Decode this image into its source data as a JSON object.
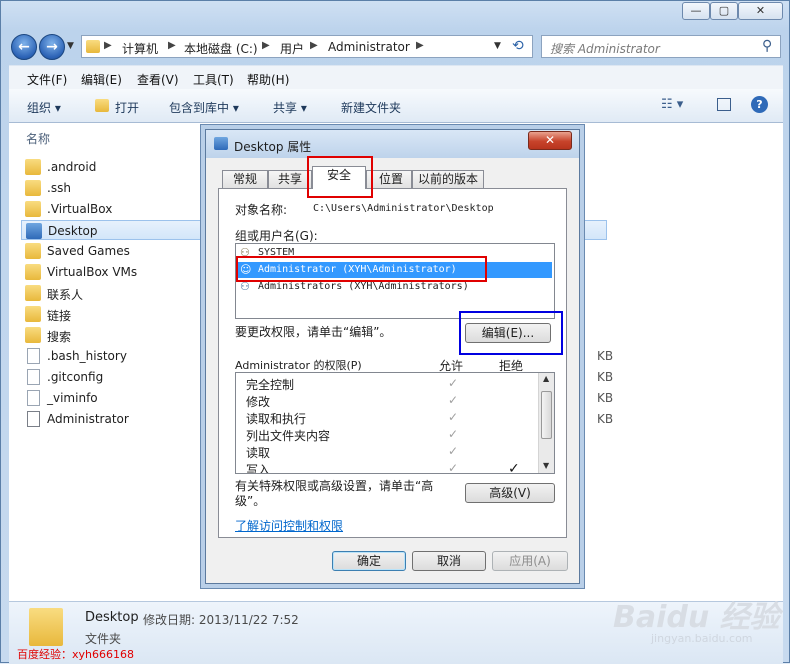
{
  "window": {
    "min_icon": "minimize-icon",
    "max_icon": "maximize-icon",
    "close_icon": "close-icon"
  },
  "address": {
    "crumbs": [
      "计算机",
      "本地磁盘 (C:)",
      "用户",
      "Administrator"
    ],
    "search_placeholder": "搜索 Administrator"
  },
  "menu": [
    "文件(F)",
    "编辑(E)",
    "查看(V)",
    "工具(T)",
    "帮助(H)"
  ],
  "toolbar": {
    "organize": "组织 ▾",
    "open": "打开",
    "include_in_library": "包含到库中 ▾",
    "share": "共享 ▾",
    "new_folder": "新建文件夹"
  },
  "list": {
    "column_name": "名称",
    "items": [
      {
        "name": ".android",
        "type": "folder"
      },
      {
        "name": ".ssh",
        "type": "folder"
      },
      {
        "name": ".VirtualBox",
        "type": "folder"
      },
      {
        "name": "Desktop",
        "type": "folder-desktop",
        "selected": true
      },
      {
        "name": "Saved Games",
        "type": "folder"
      },
      {
        "name": "VirtualBox VMs",
        "type": "folder"
      },
      {
        "name": "联系人",
        "type": "folder-contacts"
      },
      {
        "name": "链接",
        "type": "folder-links"
      },
      {
        "name": "搜索",
        "type": "folder-search"
      },
      {
        "name": ".bash_history",
        "type": "file",
        "size": "KB"
      },
      {
        "name": ".gitconfig",
        "type": "file",
        "size": "KB"
      },
      {
        "name": "_viminfo",
        "type": "file",
        "size": "KB"
      },
      {
        "name": "Administrator",
        "type": "file-special",
        "size": "KB"
      }
    ]
  },
  "details": {
    "name": "Desktop",
    "modified_label": "修改日期: 2013/11/22 7:52",
    "type": "文件夹"
  },
  "watermark": {
    "baidu": "Baidu 经验",
    "site": "jingyan.baidu.com",
    "author": "百度经验：xyh666168"
  },
  "dialog": {
    "title": "Desktop 属性",
    "tabs": [
      "常规",
      "共享",
      "安全",
      "位置",
      "以前的版本"
    ],
    "active_tab": "安全",
    "object_label": "对象名称:",
    "object_value": "C:\\Users\\Administrator\\Desktop",
    "group_label": "组或用户名(G):",
    "users": [
      {
        "name": "SYSTEM",
        "selected": false
      },
      {
        "name": "Administrator (XYH\\Administrator)",
        "selected": true
      },
      {
        "name": "Administrators (XYH\\Administrators)",
        "selected": false
      }
    ],
    "change_hint": "要更改权限，请单击“编辑”。",
    "edit_button": "编辑(E)...",
    "perm_title": "Administrator 的权限(P)",
    "allow_header": "允许",
    "deny_header": "拒绝",
    "permissions": [
      {
        "name": "完全控制",
        "allow": true,
        "deny": false
      },
      {
        "name": "修改",
        "allow": true,
        "deny": false
      },
      {
        "name": "读取和执行",
        "allow": true,
        "deny": false
      },
      {
        "name": "列出文件夹内容",
        "allow": true,
        "deny": false
      },
      {
        "name": "读取",
        "allow": true,
        "deny": false
      },
      {
        "name": "写入",
        "allow": true,
        "deny": true
      }
    ],
    "special_hint": "有关特殊权限或高级设置，请单击“高级”。",
    "advanced_button": "高级(V)",
    "learn_link": "了解访问控制和权限",
    "ok": "确定",
    "cancel": "取消",
    "apply": "应用(A)"
  }
}
